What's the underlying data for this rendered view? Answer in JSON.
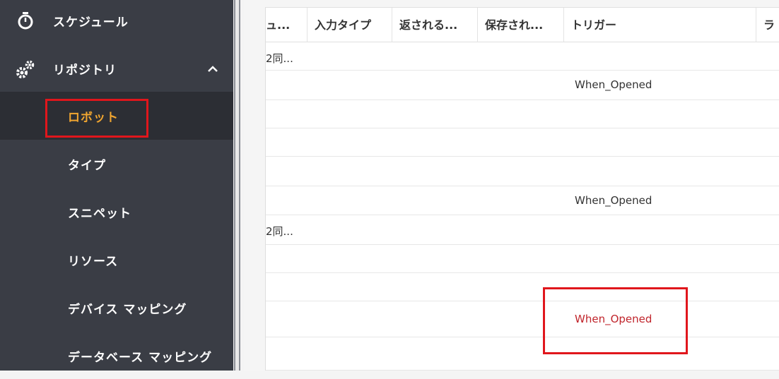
{
  "sidebar": {
    "items": [
      {
        "label": "スケジュール",
        "icon": "stopwatch-icon"
      },
      {
        "label": "リポジトリ",
        "icon": "gears-icon",
        "expanded": true
      },
      {
        "label": "ロボット",
        "selected": true
      },
      {
        "label": "タイプ"
      },
      {
        "label": "スニペット"
      },
      {
        "label": "リソース"
      },
      {
        "label": "デバイス マッピング"
      },
      {
        "label": "データベース マッピング"
      }
    ]
  },
  "table": {
    "columns": [
      "ュ...",
      "入力タイプ",
      "返される...",
      "保存され...",
      "トリガー",
      "ラ"
    ],
    "rows": [
      {
        "first": "2同...",
        "trigger": ""
      },
      {
        "first": "",
        "trigger": "When_Opened"
      },
      {
        "first": "",
        "trigger": ""
      },
      {
        "first": "",
        "trigger": ""
      },
      {
        "first": "",
        "trigger": ""
      },
      {
        "first": "",
        "trigger": "When_Opened"
      },
      {
        "first": "2同...",
        "trigger": ""
      },
      {
        "first": "",
        "trigger": ""
      },
      {
        "first": "",
        "trigger": ""
      },
      {
        "first": "",
        "trigger": "When_Opened",
        "highlighted": true
      },
      {
        "first": "",
        "trigger": ""
      }
    ]
  },
  "colors": {
    "sidebar_bg": "#3a3d45",
    "selected_bg": "#2c2e34",
    "selected_text": "#f0a530",
    "highlight_red": "#e0161c",
    "trigger_red": "#c0242b"
  }
}
